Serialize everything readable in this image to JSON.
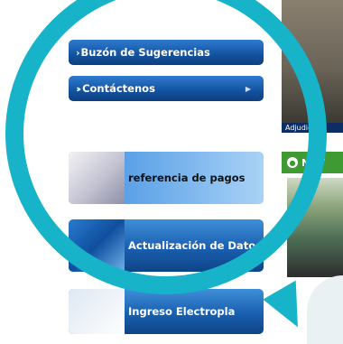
{
  "menu": {
    "items": [
      {
        "label": "Buzón de Sugerencias",
        "has_arrow": false
      },
      {
        "label": "Contáctenos",
        "has_arrow": true
      }
    ]
  },
  "banners": [
    {
      "label": "referencia de pagos"
    },
    {
      "label": "Actualización de Datos"
    },
    {
      "label": "Ingreso Electropla"
    }
  ],
  "sidebar": {
    "caption": "Adjudic",
    "news_tab": "NOT"
  },
  "colors": {
    "menu_blue": "#13529f",
    "ring_teal": "#17b3c9",
    "news_green": "#3f9a34"
  }
}
